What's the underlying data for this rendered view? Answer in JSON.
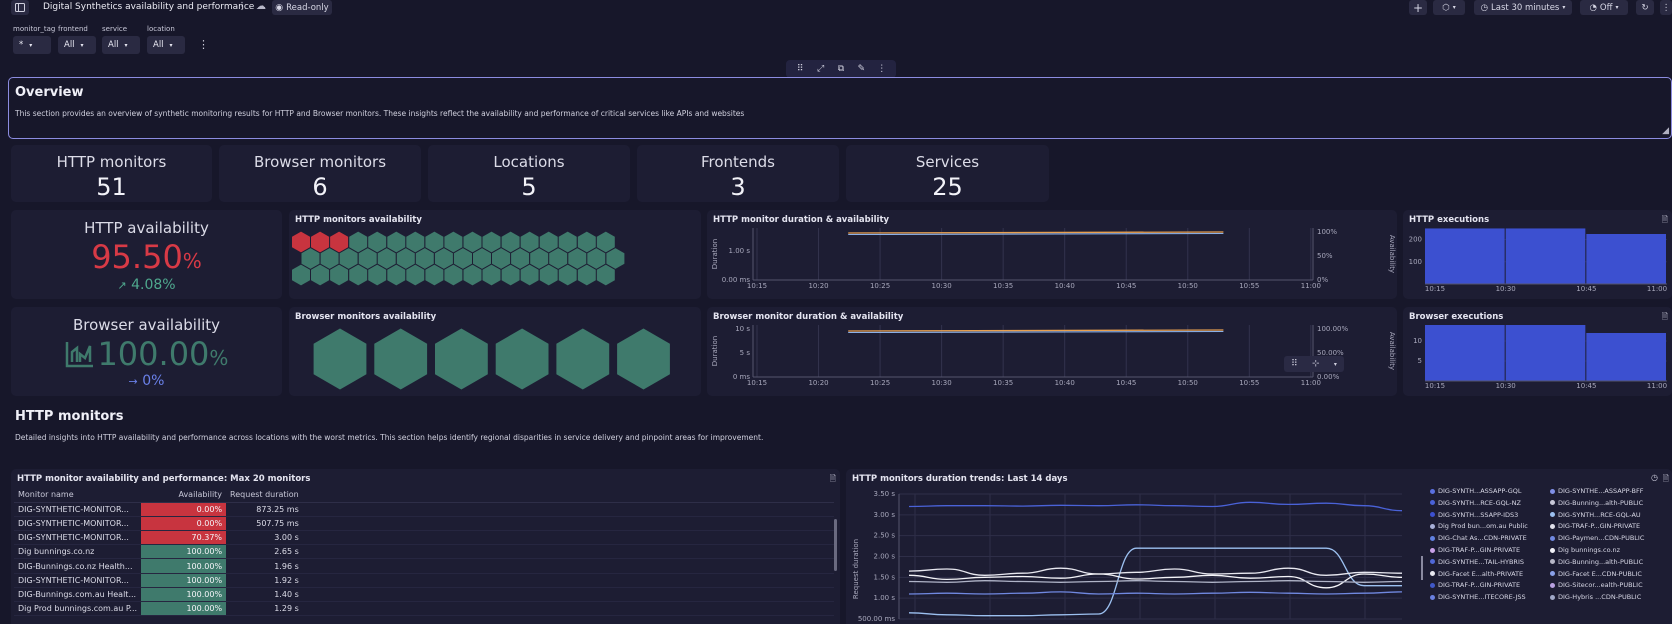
{
  "header": {
    "title": "Digital Synthetics availability and performance",
    "readonly_label": "Read-only",
    "timeframe_label": "Last 30 minutes",
    "refresh_label": "Off"
  },
  "filters": [
    {
      "label": "monitor_tag",
      "value": "*"
    },
    {
      "label": "frontend",
      "value": "All"
    },
    {
      "label": "service",
      "value": "All"
    },
    {
      "label": "location",
      "value": "All"
    }
  ],
  "overview": {
    "title": "Overview",
    "description": "This section provides an overview of synthetic monitoring results for HTTP and Browser monitors. These insights reflect the availability and performance of critical services like APIs and websites"
  },
  "kpis": [
    {
      "label": "HTTP monitors",
      "value": "51"
    },
    {
      "label": "Browser monitors",
      "value": "6"
    },
    {
      "label": "Locations",
      "value": "5"
    },
    {
      "label": "Frontends",
      "value": "3"
    },
    {
      "label": "Services",
      "value": "25"
    }
  ],
  "http_availability": {
    "label": "HTTP availability",
    "value": "95.50",
    "unit": "%",
    "trend": "4.08%"
  },
  "browser_availability": {
    "label": "Browser availability",
    "value": "100.00",
    "unit": "%",
    "trend": "0%"
  },
  "colors": {
    "bad": "#c8343f",
    "good": "#3f7a6c",
    "accent": "#3c50d0",
    "line_blue": "#6678e8"
  },
  "http_hex": {
    "title": "HTTP monitors availability",
    "total": 51,
    "failing": 3
  },
  "browser_hex": {
    "title": "Browser monitors availability",
    "total": 6,
    "failing": 0
  },
  "charts": {
    "http_duration_title": "HTTP monitor duration & availability",
    "browser_duration_title": "Browser monitor duration & availability",
    "http_exec_title": "HTTP executions",
    "browser_exec_title": "Browser executions",
    "trends_title": "HTTP monitors duration trends: Last 14 days"
  },
  "chart_data": [
    {
      "type": "line",
      "title": "HTTP monitor duration & availability",
      "x": [
        "10:15",
        "10:20",
        "10:25",
        "10:30",
        "10:35",
        "10:40",
        "10:45",
        "10:50",
        "10:55",
        "11:00"
      ],
      "ylabel": "Duration",
      "y2label": "Availability",
      "y_ticks": [
        "0.00 ms",
        "1.00 s"
      ],
      "y2_ticks": [
        "0%",
        "50%",
        "100%"
      ],
      "series": []
    },
    {
      "type": "line",
      "title": "Browser monitor duration & availability",
      "x": [
        "10:15",
        "10:20",
        "10:25",
        "10:30",
        "10:35",
        "10:40",
        "10:45",
        "10:50",
        "10:55",
        "11:00"
      ],
      "ylabel": "Duration",
      "y2label": "Availability",
      "y_ticks": [
        "0 ms",
        "5 s",
        "10 s"
      ],
      "y2_ticks": [
        "0.00%",
        "50.00%",
        "100.00%"
      ],
      "series": []
    },
    {
      "type": "bar",
      "title": "HTTP executions",
      "categories": [
        "10:15-10:30",
        "10:30-10:45",
        "10:45-11:00"
      ],
      "values": [
        250,
        250,
        225
      ],
      "x_ticks": [
        "10:15",
        "10:30",
        "10:45",
        "11:00"
      ],
      "y_ticks": [
        "100",
        "200"
      ],
      "ylim": [
        0,
        270
      ]
    },
    {
      "type": "bar",
      "title": "Browser executions",
      "categories": [
        "10:15-10:30",
        "10:30-10:45",
        "10:45-11:00"
      ],
      "values": [
        14,
        14,
        12
      ],
      "x_ticks": [
        "10:15",
        "10:30",
        "10:45",
        "11:00"
      ],
      "y_ticks": [
        "5",
        "10"
      ],
      "ylim": [
        0,
        15
      ]
    },
    {
      "type": "line",
      "title": "HTTP monitors duration trends: Last 14 days",
      "ylabel": "Request duration",
      "y_ticks": [
        "500.00 ms",
        "1.00 s",
        "1.50 s",
        "2.00 s",
        "2.50 s",
        "3.00 s",
        "3.50 s"
      ],
      "ylim": [
        0.5,
        3.5
      ],
      "series": [
        {
          "color": "#4a62d8",
          "values": [
            3.2,
            3.22,
            3.22,
            3.21,
            3.23,
            3.22,
            3.24,
            3.22,
            3.2,
            3.3,
            3.25,
            3.28,
            3.22,
            3.1
          ]
        },
        {
          "color": "#9cc0f0",
          "values": [
            0.65,
            0.6,
            0.58,
            0.58,
            0.6,
            0.62,
            2.2,
            2.2,
            2.2,
            2.2,
            2.2,
            2.2,
            1.3,
            1.3
          ]
        },
        {
          "color": "#e8e8f0",
          "values": [
            1.65,
            1.7,
            1.55,
            1.6,
            1.72,
            1.58,
            1.62,
            1.7,
            1.58,
            1.6,
            1.72,
            1.55,
            1.62,
            1.6
          ]
        },
        {
          "color": "#f4f4f8",
          "values": [
            1.55,
            1.45,
            1.5,
            1.52,
            1.48,
            1.58,
            1.46,
            1.5,
            1.55,
            1.48,
            1.52,
            1.25,
            1.58,
            1.5
          ]
        },
        {
          "color": "#b0b4c8",
          "values": [
            1.4,
            1.38,
            1.42,
            1.4,
            1.38,
            1.4,
            1.42,
            1.4,
            1.38,
            1.4,
            1.42,
            1.4,
            1.38,
            1.4
          ]
        },
        {
          "color": "#7088e0",
          "values": [
            1.1,
            1.12,
            1.1,
            1.12,
            1.15,
            1.1,
            1.12,
            1.1,
            1.12,
            1.14,
            1.12,
            1.1,
            1.12,
            1.15
          ]
        }
      ]
    }
  ],
  "http_section": {
    "title": "HTTP monitors",
    "description": "Detailed insights into HTTP availability and performance across locations with the worst metrics. This section helps identify regional disparities in service delivery and pinpoint areas for improvement."
  },
  "monitor_table": {
    "title": "HTTP monitor availability and performance: Max 20 monitors",
    "headers": [
      "Monitor name",
      "Availability",
      "Request duration"
    ],
    "rows": [
      {
        "name": "DIG-SYNTHETIC-MONITOR...",
        "availability": "0.00%",
        "duration": "873.25 ms",
        "status": "bad"
      },
      {
        "name": "DIG-SYNTHETIC-MONITOR...",
        "availability": "0.00%",
        "duration": "507.75 ms",
        "status": "bad"
      },
      {
        "name": "DIG-SYNTHETIC-MONITOR...",
        "availability": "70.37%",
        "duration": "3.00 s",
        "status": "bad"
      },
      {
        "name": "Dig bunnings.co.nz",
        "availability": "100.00%",
        "duration": "2.65 s",
        "status": "good"
      },
      {
        "name": "DIG-Bunnings.co.nz Health...",
        "availability": "100.00%",
        "duration": "1.96 s",
        "status": "good"
      },
      {
        "name": "DIG-SYNTHETIC-MONITOR...",
        "availability": "100.00%",
        "duration": "1.92 s",
        "status": "good"
      },
      {
        "name": "DIG-Bunnings.com.au Healt...",
        "availability": "100.00%",
        "duration": "1.40 s",
        "status": "good"
      },
      {
        "name": "Dig Prod bunnings.com.au P...",
        "availability": "100.00%",
        "duration": "1.29 s",
        "status": "good"
      }
    ]
  },
  "trend_legend": [
    {
      "label": "DIG-SYNTH...ASSAPP-GQL",
      "color": "#5a70e0"
    },
    {
      "label": "DIG-SYNTHE...ASSAPP-BFF",
      "color": "#8090e8"
    },
    {
      "label": "DIG-SYNTH...RCE-GQL-NZ",
      "color": "#4a62d8"
    },
    {
      "label": "DIG-Bunning...alth-PUBLIC",
      "color": "#c8c8d8"
    },
    {
      "label": "DIG-SYNTH...SSAPP-IDS3",
      "color": "#3c50d0"
    },
    {
      "label": "DIG-SYNTH...RCE-GQL-AU",
      "color": "#9cc0f0"
    },
    {
      "label": "Dig Prod bun...om.au Public",
      "color": "#a8b0d8"
    },
    {
      "label": "DIG-TRAF-P...GIN-PRIVATE",
      "color": "#e0e0ea"
    },
    {
      "label": "DIG-Chat As...CDN-PRIVATE",
      "color": "#6080e0"
    },
    {
      "label": "DIG-Paymen...CDN-PUBLIC",
      "color": "#7088e0"
    },
    {
      "label": "DIG-TRAF-P...GIN-PRIVATE",
      "color": "#c8a0e8"
    },
    {
      "label": "Dig bunnings.co.nz",
      "color": "#f0f0f6"
    },
    {
      "label": "DIG-SYNTHE...TAIL-HYBRIS",
      "color": "#5068d8"
    },
    {
      "label": "DIG-Bunning...alth-PUBLIC",
      "color": "#b8b8c8"
    },
    {
      "label": "DIG-Facet E...alth-PRIVATE",
      "color": "#e8e8f0"
    },
    {
      "label": "DIG-Facet E...CDN-PUBLIC",
      "color": "#8aa0e8"
    },
    {
      "label": "DIG-TRAF-P...GIN-PRIVATE",
      "color": "#4058c8"
    },
    {
      "label": "DIG-Sitecor...ealth-PUBLIC",
      "color": "#b8a0e0"
    },
    {
      "label": "DIG-SYNTHE...ITECORE-JSS",
      "color": "#6a80e0"
    },
    {
      "label": "DIG-Hybris ...CDN-PUBLIC",
      "color": "#a0a8c8"
    }
  ]
}
